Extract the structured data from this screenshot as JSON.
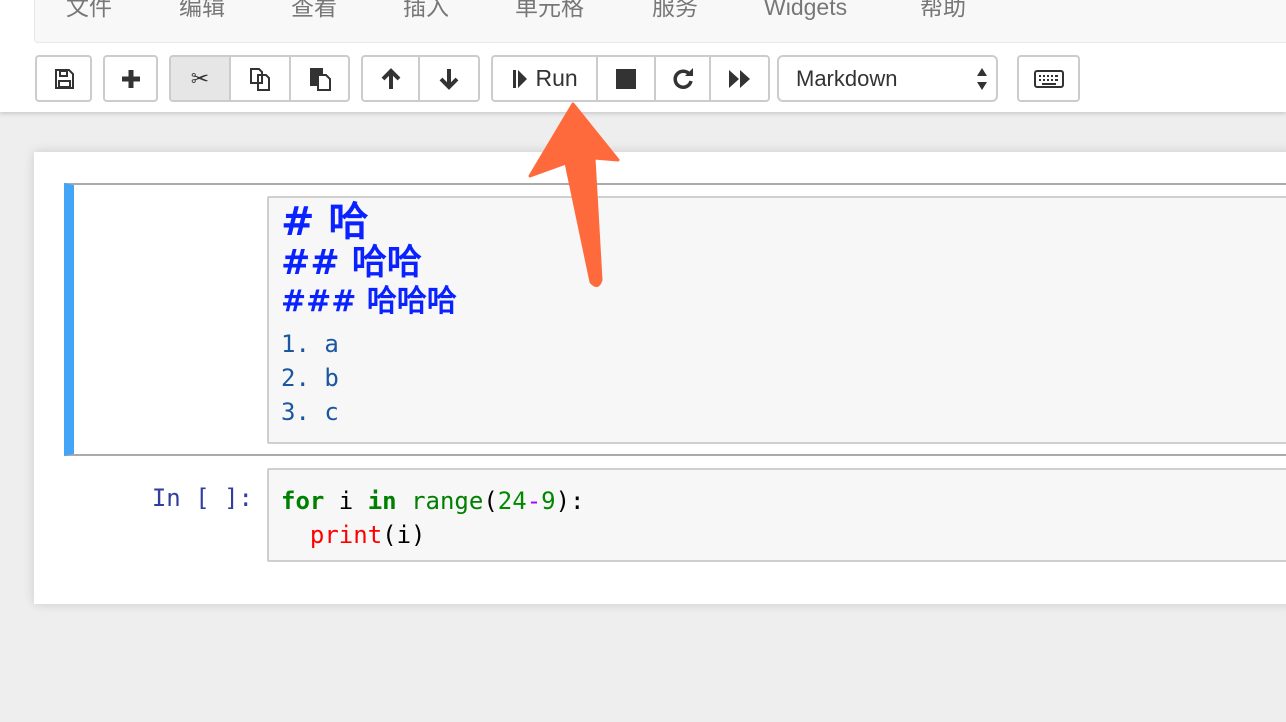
{
  "menu": [
    "文件",
    "编辑",
    "查看",
    "插入",
    "单元格",
    "服务",
    "Widgets",
    "帮助"
  ],
  "toolbar": {
    "run_label": "Run",
    "cell_type": "Markdown",
    "icons": [
      "save-icon",
      "plus-icon",
      "cut-icon",
      "copy-icon",
      "paste-icon",
      "arrow-up-icon",
      "arrow-down-icon",
      "step-forward-icon",
      "stop-icon",
      "restart-icon",
      "fast-forward-icon",
      "keyboard-icon"
    ]
  },
  "cells": [
    {
      "type": "markdown",
      "lines": {
        "h1": "# 哈",
        "h2": "## 哈哈",
        "h3": "### 哈哈哈",
        "items": [
          "1. a",
          "2. b",
          "3. c"
        ]
      }
    },
    {
      "type": "code",
      "prompt": "In [ ]:",
      "code": {
        "kw_for": "for",
        "var": " i ",
        "kw_in": "in",
        "fn": "range",
        "lp": "(",
        "n1": "24",
        "op": "-",
        "n2": "9",
        "rp": "):",
        "indent": "  ",
        "print": "print",
        "args": "(i)"
      }
    }
  ],
  "colors": {
    "accent_arrow": "#ff6a3d",
    "selected_cell": "#42a5f5",
    "heading": "#0a22ff"
  }
}
